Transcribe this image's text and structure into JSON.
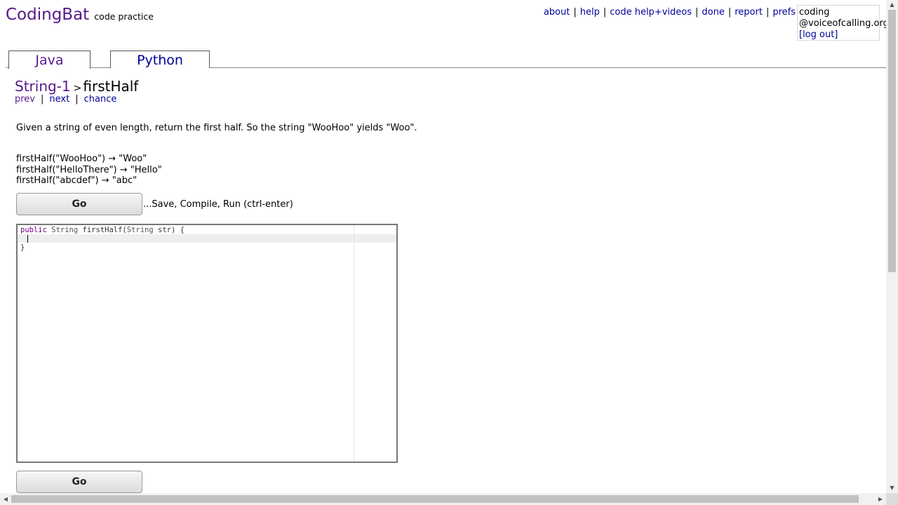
{
  "header": {
    "logo_main": "CodingBat",
    "logo_sub": "code practice",
    "nav": [
      "about",
      "help",
      "code help+videos",
      "done",
      "report",
      "prefs"
    ],
    "user": {
      "line1": "coding",
      "line2": "@voiceofcalling.org",
      "logout": "[log out]"
    }
  },
  "tabs": [
    {
      "label": "Java",
      "active": true
    },
    {
      "label": "Python",
      "active": false
    }
  ],
  "breadcrumb": {
    "section": "String-1",
    "arrow": ">",
    "problem": "firstHalf"
  },
  "subnav": [
    "prev",
    "next",
    "chance"
  ],
  "description": "Given a string of even length, return the first half. So the string \"WooHoo\" yields \"Woo\".",
  "examples": [
    "firstHalf(\"WooHoo\") → \"Woo\"",
    "firstHalf(\"HelloThere\") → \"Hello\"",
    "firstHalf(\"abcdef\") → \"abc\""
  ],
  "go_button": {
    "label": "Go",
    "hint": "...Save, Compile, Run (ctrl-enter)"
  },
  "editor": {
    "line1_kw": "public",
    "line1_type": "String",
    "line1_rest": "firstHalf(",
    "line1_param_type": "String",
    "line1_tail": "str) {",
    "line3": "}"
  },
  "colors": {
    "link": "#000099",
    "visited": "#551a8b"
  }
}
